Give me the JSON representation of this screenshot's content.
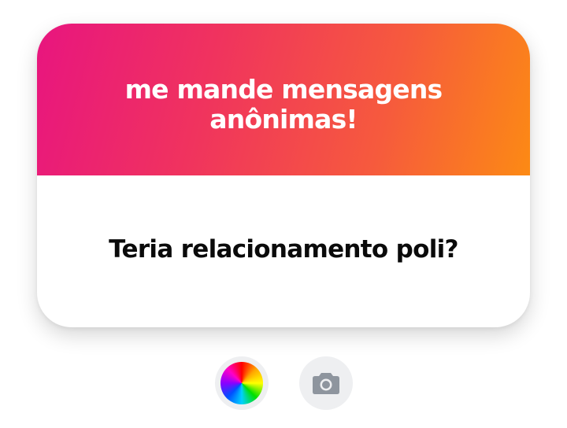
{
  "card": {
    "title": "me mande mensagens anônimas!",
    "question": "Teria relacionamento poli?",
    "gradient_colors": [
      "#e8157f",
      "#fc8a14"
    ]
  },
  "controls": {
    "color_button_icon": "color-wheel-icon",
    "camera_button_icon": "camera-icon"
  }
}
